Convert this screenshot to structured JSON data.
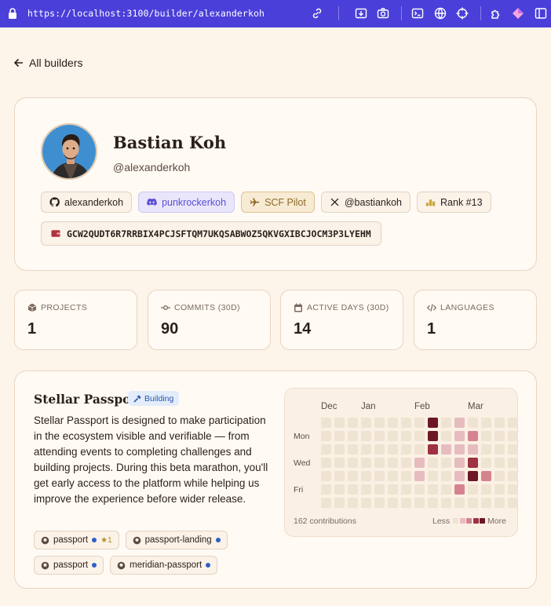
{
  "browser": {
    "url": "https://localhost:3100/builder/alexanderkoh"
  },
  "nav": {
    "back_label": "All builders"
  },
  "profile": {
    "name": "Bastian Koh",
    "handle": "@alexanderkoh",
    "badges": [
      {
        "icon": "github-icon",
        "label": "alexanderkoh"
      },
      {
        "icon": "discord-icon",
        "label": "punkrockerkoh"
      },
      {
        "icon": "plane-icon",
        "label": "SCF Pilot"
      },
      {
        "icon": "x-icon",
        "label": "@bastiankoh"
      },
      {
        "icon": "rank-icon",
        "label": "Rank #13"
      }
    ],
    "wallet": "GCW2QUDT6R7RRBIX4PCJSFTQM7UKQSABWOZ5QKVGXIBCJOCM3P3LYEHM"
  },
  "stats": [
    {
      "label": "PROJECTS",
      "value": "1",
      "icon": "box-icon"
    },
    {
      "label": "COMMITS (30D)",
      "value": "90",
      "icon": "commit-icon"
    },
    {
      "label": "ACTIVE DAYS (30D)",
      "value": "14",
      "icon": "calendar-icon"
    },
    {
      "label": "LANGUAGES",
      "value": "1",
      "icon": "code-icon"
    }
  ],
  "project": {
    "title": "Stellar Passport",
    "status": "Building",
    "description": "Stellar Passport is designed to make participation in the ecosystem visible and verifiable — from attending events to completing challenges and building projects. During this beta marathon, you'll get early access to the platform while helping us improve the experience before wider release.",
    "repos": [
      {
        "name": "passport",
        "stars": "★1"
      },
      {
        "name": "passport-landing",
        "stars": ""
      },
      {
        "name": "passport",
        "stars": ""
      },
      {
        "name": "meridian-passport",
        "stars": ""
      }
    ],
    "heatmap": {
      "months": [
        "Dec",
        "Jan",
        "Feb",
        "Mar"
      ],
      "days": [
        "Mon",
        "Wed",
        "Fri"
      ],
      "contributions": "162 contributions",
      "less": "Less",
      "more": "More",
      "colors": [
        "#efe3d2",
        "#e6bcc1",
        "#d5838f",
        "#9e3142",
        "#6d1626"
      ],
      "levels": [
        [
          0,
          0,
          0,
          0,
          0,
          0,
          0,
          0,
          4,
          0,
          1,
          0,
          0,
          0,
          0
        ],
        [
          0,
          0,
          0,
          0,
          0,
          0,
          0,
          0,
          4,
          0,
          1,
          2,
          0,
          0,
          0
        ],
        [
          0,
          0,
          0,
          0,
          0,
          0,
          0,
          0,
          3,
          1,
          1,
          1,
          0,
          0,
          0
        ],
        [
          0,
          0,
          0,
          0,
          0,
          0,
          0,
          1,
          0,
          0,
          1,
          3,
          0,
          0,
          0
        ],
        [
          0,
          0,
          0,
          0,
          0,
          0,
          0,
          1,
          0,
          0,
          1,
          4,
          2,
          0,
          0
        ],
        [
          0,
          0,
          0,
          0,
          0,
          0,
          0,
          0,
          0,
          0,
          2,
          0,
          0,
          0,
          0
        ],
        [
          0,
          0,
          0,
          0,
          0,
          0,
          0,
          0,
          0,
          0,
          0,
          0,
          0,
          0,
          0
        ]
      ]
    }
  }
}
